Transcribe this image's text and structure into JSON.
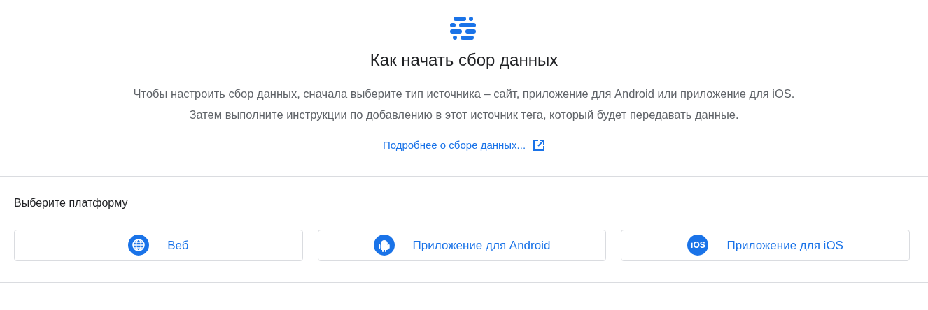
{
  "title": "Как начать сбор данных",
  "description": [
    "Чтобы настроить сбор данных, сначала выберите тип источника – сайт, приложение для Android или приложение для iOS.",
    "Затем выполните инструкции по добавлению в этот источник тега, который будет передавать данные."
  ],
  "link": "Подробнее о сборе данных...",
  "platform_section": {
    "heading": "Выберите платформу",
    "platforms": [
      {
        "kind": "web",
        "label": "Веб"
      },
      {
        "kind": "android",
        "label": "Приложение для Android"
      },
      {
        "kind": "ios",
        "label": "Приложение для iOS",
        "icon_text": "iOS"
      }
    ]
  }
}
